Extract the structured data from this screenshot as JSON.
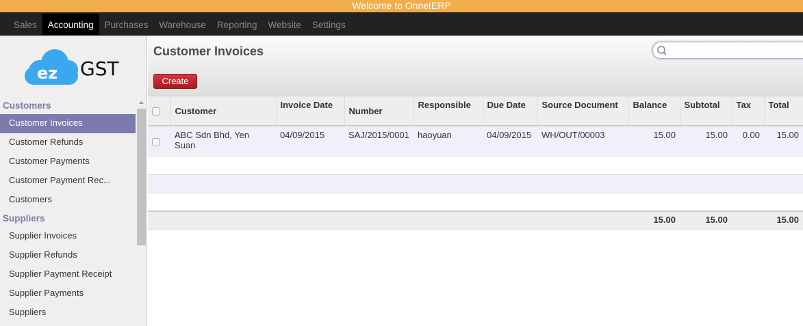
{
  "topbar": {
    "title": "Welcome to OnnetERP"
  },
  "nav": {
    "items": [
      {
        "label": "Sales"
      },
      {
        "label": "Accounting"
      },
      {
        "label": "Purchases"
      },
      {
        "label": "Warehouse"
      },
      {
        "label": "Reporting"
      },
      {
        "label": "Website"
      },
      {
        "label": "Settings"
      }
    ],
    "active": "Accounting"
  },
  "logo": {
    "text": "GST",
    "mark": "ez"
  },
  "sidebar": {
    "sections": [
      {
        "title": "Customers",
        "items": [
          "Customer Invoices",
          "Customer Refunds",
          "Customer Payments",
          "Customer Payment Rec...",
          "Customers"
        ]
      },
      {
        "title": "Suppliers",
        "items": [
          "Supplier Invoices",
          "Supplier Refunds",
          "Supplier Payment Receipt",
          "Supplier Payments",
          "Suppliers"
        ]
      }
    ]
  },
  "main": {
    "title": "Customer Invoices",
    "create_label": "Create",
    "search": {
      "value": "",
      "placeholder": ""
    },
    "columns": [
      "Customer",
      "Invoice Date",
      "Number",
      "Responsible",
      "Due Date",
      "Source Document",
      "Balance",
      "Subtotal",
      "Tax",
      "Total"
    ],
    "rows": [
      [
        "ABC Sdn Bhd, Yen Suan",
        "04/09/2015",
        "SAJ/2015/0001",
        "haoyuan",
        "04/09/2015",
        "WH/OUT/00003",
        "15.00",
        "15.00",
        "0.00",
        "15.00"
      ]
    ],
    "totals": {
      "balance": "15.00",
      "subtotal": "15.00",
      "tax": "",
      "total": "15.00"
    }
  },
  "colors": {
    "topbar": "#f0ad4e",
    "accent": "#7c7bad",
    "create": "#c02a31"
  }
}
